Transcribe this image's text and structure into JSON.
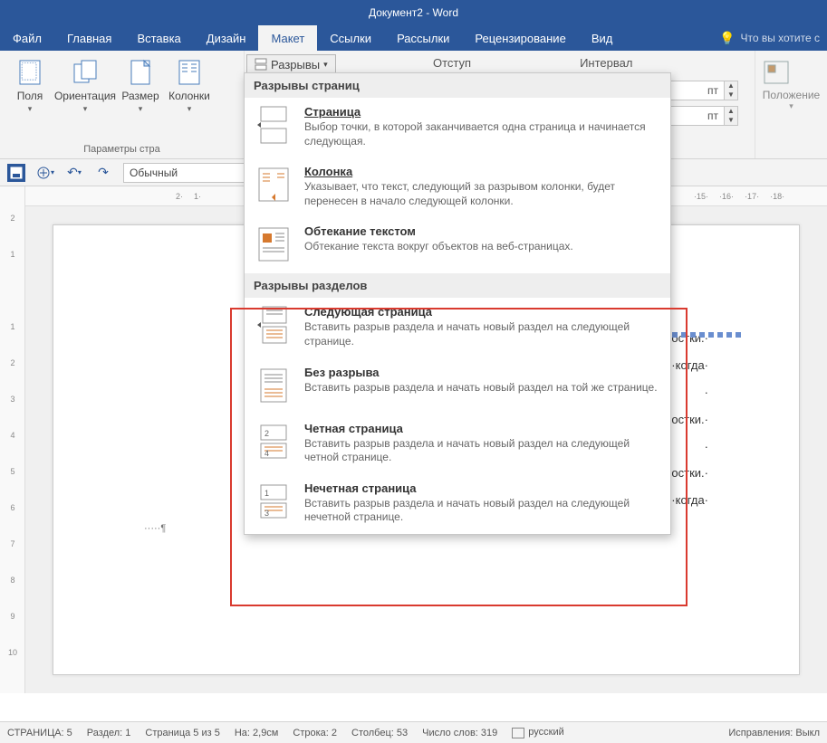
{
  "title": "Документ2 - Word",
  "menu": {
    "file": "Файл",
    "home": "Главная",
    "insert": "Вставка",
    "design": "Дизайн",
    "layout": "Макет",
    "references": "Ссылки",
    "mailings": "Рассылки",
    "review": "Рецензирование",
    "view": "Вид",
    "tell_me": "Что вы хотите с"
  },
  "ribbon": {
    "margins": "Поля",
    "orientation": "Ориентация",
    "size": "Размер",
    "columns": "Колонки",
    "breaks": "Разрывы",
    "indent": "Отступ",
    "spacing": "Интервал",
    "page_setup_group": "Параметры стра",
    "position": "Положение",
    "spinner_unit": "пт"
  },
  "qat": {
    "style": "Обычный"
  },
  "hruler_before": [
    "2",
    "1"
  ],
  "hruler_after": [
    "15",
    "16",
    "17",
    "18"
  ],
  "vruler": [
    "2",
    "1",
    "",
    "1",
    "2",
    "3",
    "4",
    "5",
    "6",
    "7",
    "8",
    "9",
    "10"
  ],
  "dropdown": {
    "section1_header": "Разрывы страниц",
    "page_title": "Страница",
    "page_desc": "Выбор точки, в которой заканчивается одна страница и начинается следующая.",
    "column_title": "Колонка",
    "column_desc": "Указывает, что текст, следующий за разрывом колонки, будет перенесен в начало следующей колонки.",
    "wrap_title": "Обтекание текстом",
    "wrap_desc": "Обтекание текста вокруг объектов на веб-страницах.",
    "section2_header": "Разрывы разделов",
    "next_title": "Следующая страница",
    "next_desc": "Вставить разрыв раздела и начать новый раздел на следующей странице.",
    "cont_title": "Без разрыва",
    "cont_desc": "Вставить разрыв раздела и начать новый раздел на той же странице.",
    "even_title": "Четная страница",
    "even_desc": "Вставить разрыв раздела и начать новый раздел на следующей четной странице.",
    "odd_title": "Нечетная страница",
    "odd_desc": "Вставить разрыв раздела и начать новый раздел на следующей нечетной странице."
  },
  "doc": {
    "l1": "остки.·",
    "l2": "гг.·когда·",
    "l3": "·",
    "l4": "остки.·",
    "l5": "·",
    "l6": "остки.·",
    "l7": "гг.·когда·",
    "end": "·····¶"
  },
  "status": {
    "page_label": "СТРАНИЦА: 5",
    "section": "Раздел: 1",
    "page_of": "Страница 5 из 5",
    "at": "На: 2,9см",
    "line": "Строка: 2",
    "col": "Столбец: 53",
    "words": "Число слов: 319",
    "lang": "русский",
    "track": "Исправления: Выкл"
  }
}
